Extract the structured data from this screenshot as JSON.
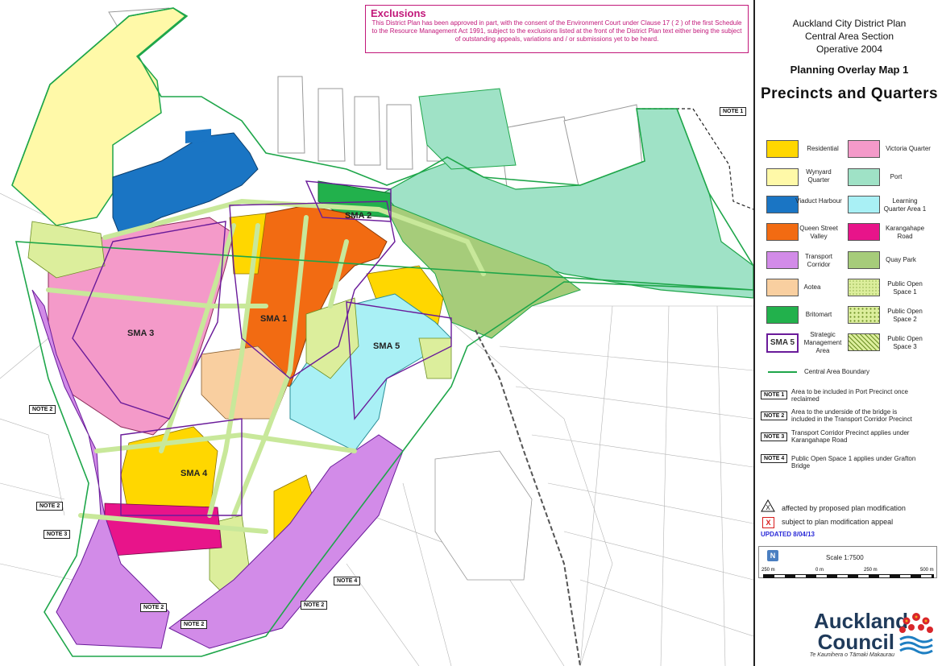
{
  "exclusions": {
    "heading": "Exclusions",
    "body": "This District Plan has been approved in part, with the consent of the Environment Court under Clause 17 ( 2 ) of the first Schedule to the Resource Management Act 1991, subject to the exclusions listed at the front of the District Plan text either being the subject of outstanding appeals, variations and / or submissions yet to be heard."
  },
  "panel": {
    "title_line1": "Auckland City District Plan",
    "title_line2": "Central Area Section",
    "title_line3": "Operative 2004",
    "overlay": "Planning Overlay Map 1",
    "heading": "Precincts and Quarters"
  },
  "legend": [
    {
      "label": "Residential",
      "color": "#ffd700"
    },
    {
      "label": "Victoria Quarter",
      "color": "#f49ac9"
    },
    {
      "label": "Wynyard Quarter",
      "color": "#fff9a8"
    },
    {
      "label": "Port",
      "color": "#9fe2c6"
    },
    {
      "label": "Viaduct Harbour",
      "color": "#1a75c4"
    },
    {
      "label": "Learning Quarter Area 1",
      "color": "#a9f0f5"
    },
    {
      "label": "Queen Street Valley",
      "color": "#f26b12"
    },
    {
      "label": "Karangahape Road",
      "color": "#e8148a"
    },
    {
      "label": "Transport Corridor",
      "color": "#d28be8"
    },
    {
      "label": "Quay Park",
      "color": "#a6cc7a"
    },
    {
      "label": "Aotea",
      "color": "#f9cfa0"
    },
    {
      "label": "Public Open Space 1",
      "color": "#dcee9c"
    },
    {
      "label": "Britomart",
      "color": "#22b14c"
    },
    {
      "label": "Public Open Space 2",
      "color": "#dcee9c"
    },
    {
      "label": "Strategic Management Area",
      "color": "#6a1b9a"
    },
    {
      "label": "Public Open Space 3",
      "color": "#dcee9c"
    }
  ],
  "sma_key": "SMA 5",
  "boundary_label": "Central Area Boundary",
  "notes": [
    {
      "tag": "NOTE 1",
      "text": "Area to be included in Port Precinct once reclaimed"
    },
    {
      "tag": "NOTE 2",
      "text": "Area to the underside of the bridge is included in the Transport Corridor Precinct"
    },
    {
      "tag": "NOTE 3",
      "text": "Transport Corridor Precinct applies under Karangahape Road"
    },
    {
      "tag": "NOTE 4",
      "text": "Public Open Space 1 applies under Grafton Bridge"
    }
  ],
  "mod_affected": "affected by proposed plan modification",
  "mod_appeal": "subject to plan modification appeal",
  "mod_symbol_x": "X",
  "updated": "UPDATED 8/04/13",
  "north": "N",
  "scale": {
    "label": "Scale 1:7500",
    "ticks": [
      "250 m",
      "0 m",
      "250 m",
      "500 m"
    ]
  },
  "logo": {
    "name_line1": "Auckland",
    "name_line2": "Council",
    "tagline": "Te Kaunihera o Tāmaki Makaurau"
  },
  "map_labels": {
    "sma1": "SMA 1",
    "sma2": "SMA 2",
    "sma3": "SMA 3",
    "sma4": "SMA 4",
    "sma5": "SMA 5",
    "note1": "NOTE 1",
    "note2": "NOTE 2",
    "note3": "NOTE 3",
    "note4": "NOTE 4"
  },
  "colors": {
    "boundary": "#1ea64a",
    "sma_outline": "#6a1b9a",
    "road": "#c8e89a"
  }
}
